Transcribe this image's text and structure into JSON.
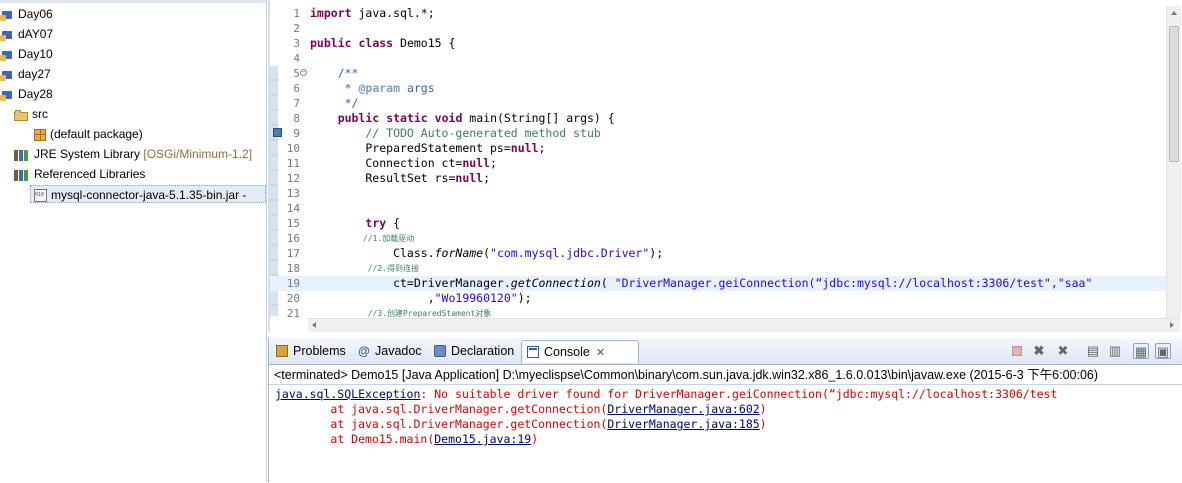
{
  "explorer": {
    "projects": [
      "Day06",
      "dAY07",
      "Day10",
      "day27",
      "Day28"
    ],
    "src": "src",
    "default_package": "(default package)",
    "jre_label": "JRE System Library",
    "jre_version": "[OSGi/Minimum-1.2]",
    "referenced_libraries": "Referenced Libraries",
    "jar": "mysql-connector-java-5.1.35-bin.jar -"
  },
  "editor": {
    "line_numbers": [
      "1",
      "2",
      "3",
      "4",
      "5",
      "6",
      "7",
      "8",
      "9",
      "10",
      "11",
      "12",
      "13",
      "14",
      "15",
      "16",
      "17",
      "18",
      "19",
      "20",
      "21"
    ],
    "l1_kw": "import",
    "l1_rest": " java.sql.*;",
    "l3_kw1": "public",
    "l3_kw2": "class",
    "l3_rest": " Demo15 {",
    "l5": "    /**",
    "l6_star": "     * ",
    "l6_tag": "@param",
    "l6_rest": " args",
    "l7": "     */",
    "l8_indent": "    ",
    "l8_kw1": "public",
    "l8_kw2": "static",
    "l8_kw3": "void",
    "l8_rest": " main(String[] args) {",
    "l9": "        // TODO Auto-generated method stub",
    "l10_pre": "        PreparedStatement ps=",
    "l10_kw": "null",
    "l10_post": ";",
    "l11_pre": "        Connection ct=",
    "l11_kw": "null",
    "l11_post": ";",
    "l12_pre": "        ResultSet rs=",
    "l12_kw": "null",
    "l12_post": ";",
    "l15_indent": "        ",
    "l15_kw": "try",
    "l15_rest": " {",
    "l16": "           //1.加载驱动",
    "l17_pre": "            Class.",
    "l17_it": "forName",
    "l17_mid": "(",
    "l17_str": "\"com.mysql.jdbc.Driver\"",
    "l17_post": ");",
    "l18": "            //2.得到连接",
    "l19_pre": "            ct=DriverManager.",
    "l19_it": "getConnection",
    "l19_mid": "( ",
    "l19_str": "\"DriverManager.geiConnection(“jdbc:mysql://localhost:3306/test\",\"saa\"",
    "l20_pre": "                 ,",
    "l20_str": "\"Wo19960120\"",
    "l20_post": ");",
    "l21": "            //3.创建PreparedStament对象"
  },
  "console_view": {
    "tabs": {
      "problems": "Problems",
      "javadoc": "Javadoc",
      "declaration": "Declaration",
      "console": "Console"
    },
    "terminated": "<terminated> Demo15 [Java Application] D:\\myeclispse\\Common\\binary\\com.sun.java.jdk.win32.x86_1.6.0.013\\bin\\javaw.exe (2015-6-3 下午6:00:06)",
    "exception_link": "java.sql.SQLException",
    "exception_msg": ": No suitable driver found for DriverManager.geiConnection(“jdbc:mysql://localhost:3306/test",
    "trace1_pre": "\tat java.sql.DriverManager.getConnection(",
    "trace1_link": "DriverManager.java:602",
    "trace1_post": ")",
    "trace2_pre": "\tat java.sql.DriverManager.getConnection(",
    "trace2_link": "DriverManager.java:185",
    "trace2_post": ")",
    "trace3_pre": "\tat Demo15.main(",
    "trace3_link": "Demo15.java:19",
    "trace3_post": ")"
  },
  "icons": {
    "project": "java-project-icon",
    "src": "source-folder-icon",
    "package": "package-icon",
    "library": "library-icon",
    "jar": "jar-file-icon"
  }
}
